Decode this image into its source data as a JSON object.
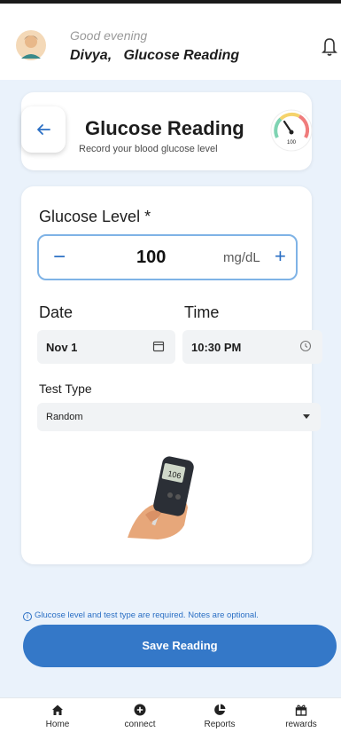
{
  "header": {
    "greeting": "Good evening",
    "user_name": "Divya,",
    "page_label": "Glucose Reading",
    "bell_icon": "bell-icon",
    "avatar_icon": "user-avatar"
  },
  "title_card": {
    "back_icon": "arrow-left-icon",
    "title": "Glucose Reading",
    "subtitle": "Record your blood glucose level",
    "gauge_icon": "gauge-icon",
    "gauge_value": "100"
  },
  "form": {
    "glucose_label": "Glucose Level *",
    "glucose_value": "100",
    "glucose_unit": "mg/dL",
    "minus_label": "−",
    "plus_label": "+",
    "date_label": "Date",
    "date_value": "Nov 1",
    "time_label": "Time",
    "time_value": "10:30 PM",
    "test_type_label": "Test Type",
    "test_type_value": "Random",
    "meter_display": "106"
  },
  "notice": {
    "icon": "info-icon",
    "text": "Glucose level and test type are required. Notes are optional."
  },
  "save_button": {
    "label": "Save Reading"
  },
  "nav": {
    "items": [
      {
        "label": "Home",
        "icon": "home-icon"
      },
      {
        "label": "connect",
        "icon": "plus-circle-icon"
      },
      {
        "label": "Reports",
        "icon": "pie-chart-icon"
      },
      {
        "label": "rewards",
        "icon": "gift-icon"
      }
    ]
  },
  "colors": {
    "accent": "#3478c8",
    "background": "#eaf2fb",
    "field_bg": "#f1f3f5"
  }
}
